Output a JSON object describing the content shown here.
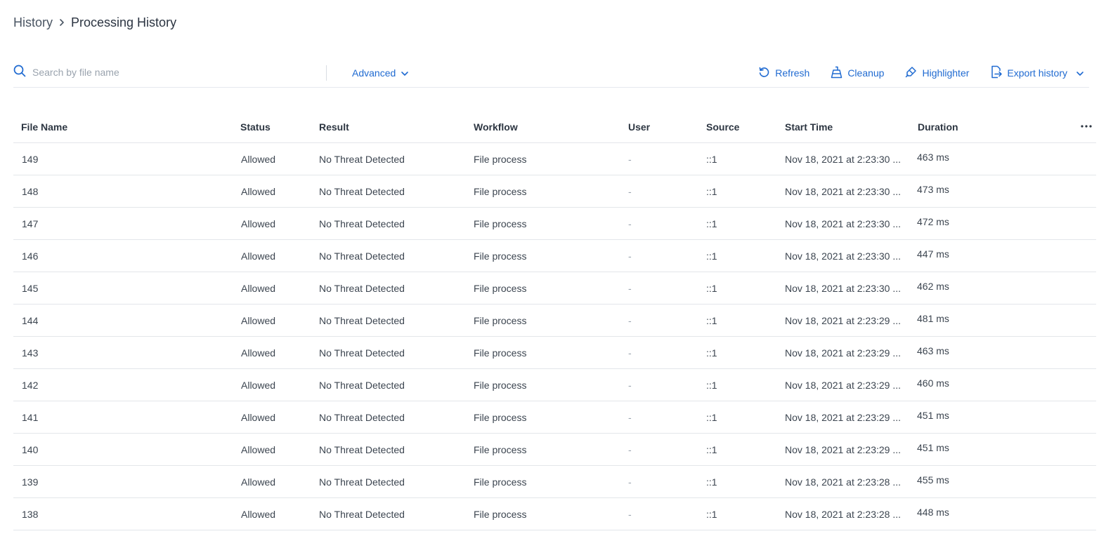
{
  "breadcrumb": {
    "root": "History",
    "current": "Processing History"
  },
  "search": {
    "placeholder": "Search by file name",
    "value": ""
  },
  "advanced": {
    "label": "Advanced"
  },
  "actions": {
    "refresh": "Refresh",
    "cleanup": "Cleanup",
    "highlighter": "Highlighter",
    "export": "Export history"
  },
  "table": {
    "columns": [
      "File Name",
      "Status",
      "Result",
      "Workflow",
      "User",
      "Source",
      "Start Time",
      "Duration"
    ],
    "rows": [
      [
        "149",
        "Allowed",
        "No Threat Detected",
        "File process",
        "-",
        "::1",
        "Nov 18, 2021 at 2:23:30 ...",
        "463 ms"
      ],
      [
        "148",
        "Allowed",
        "No Threat Detected",
        "File process",
        "-",
        "::1",
        "Nov 18, 2021 at 2:23:30 ...",
        "473 ms"
      ],
      [
        "147",
        "Allowed",
        "No Threat Detected",
        "File process",
        "-",
        "::1",
        "Nov 18, 2021 at 2:23:30 ...",
        "472 ms"
      ],
      [
        "146",
        "Allowed",
        "No Threat Detected",
        "File process",
        "-",
        "::1",
        "Nov 18, 2021 at 2:23:30 ...",
        "447 ms"
      ],
      [
        "145",
        "Allowed",
        "No Threat Detected",
        "File process",
        "-",
        "::1",
        "Nov 18, 2021 at 2:23:30 ...",
        "462 ms"
      ],
      [
        "144",
        "Allowed",
        "No Threat Detected",
        "File process",
        "-",
        "::1",
        "Nov 18, 2021 at 2:23:29 ...",
        "481 ms"
      ],
      [
        "143",
        "Allowed",
        "No Threat Detected",
        "File process",
        "-",
        "::1",
        "Nov 18, 2021 at 2:23:29 ...",
        "463 ms"
      ],
      [
        "142",
        "Allowed",
        "No Threat Detected",
        "File process",
        "-",
        "::1",
        "Nov 18, 2021 at 2:23:29 ...",
        "460 ms"
      ],
      [
        "141",
        "Allowed",
        "No Threat Detected",
        "File process",
        "-",
        "::1",
        "Nov 18, 2021 at 2:23:29 ...",
        "451 ms"
      ],
      [
        "140",
        "Allowed",
        "No Threat Detected",
        "File process",
        "-",
        "::1",
        "Nov 18, 2021 at 2:23:29 ...",
        "451 ms"
      ],
      [
        "139",
        "Allowed",
        "No Threat Detected",
        "File process",
        "-",
        "::1",
        "Nov 18, 2021 at 2:23:28 ...",
        "455 ms"
      ],
      [
        "138",
        "Allowed",
        "No Threat Detected",
        "File process",
        "-",
        "::1",
        "Nov 18, 2021 at 2:23:28 ...",
        "448 ms"
      ]
    ]
  },
  "colors": {
    "accent": "#1f6ad1",
    "text": "#2d3642",
    "muted": "#9aa3ae",
    "border": "#e3e6ea"
  },
  "icons": [
    "search-icon",
    "chevron-right-icon",
    "chevron-down-icon",
    "refresh-icon",
    "cleanup-icon",
    "highlighter-icon",
    "export-icon",
    "more-icon"
  ]
}
